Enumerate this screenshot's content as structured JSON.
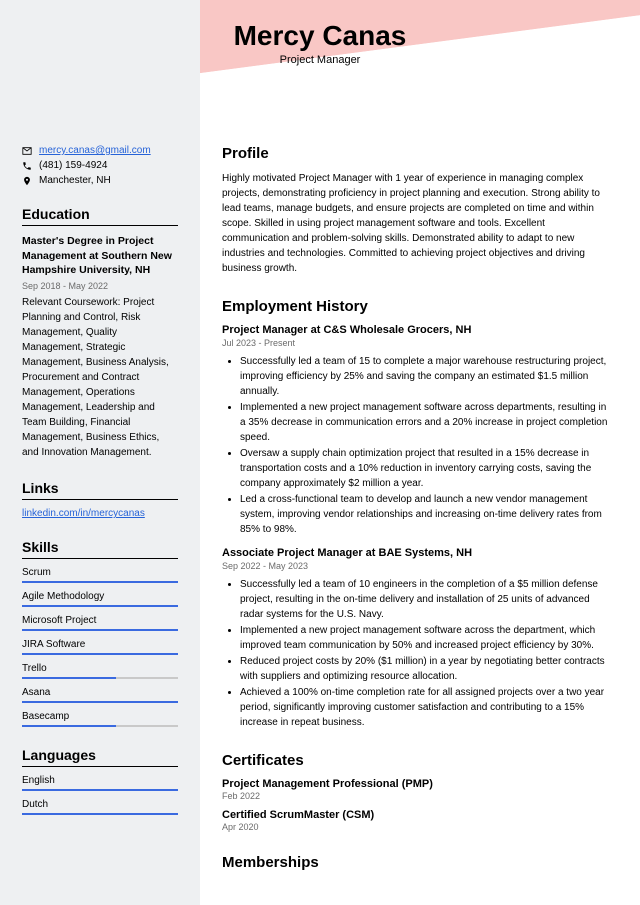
{
  "header": {
    "name": "Mercy Canas",
    "title": "Project Manager"
  },
  "contact": {
    "email": "mercy.canas@gmail.com",
    "phone": "(481) 159-4924",
    "location": "Manchester, NH"
  },
  "education": {
    "heading": "Education",
    "degree": "Master's Degree in Project Management at Southern New Hampshire University, NH",
    "dates": "Sep 2018 - May 2022",
    "coursework": "Relevant Coursework: Project Planning and Control, Risk Management, Quality Management, Strategic Management, Business Analysis, Procurement and Contract Management, Operations Management, Leadership and Team Building, Financial Management, Business Ethics, and Innovation Management."
  },
  "links": {
    "heading": "Links",
    "url": "linkedin.com/in/mercycanas"
  },
  "skills": {
    "heading": "Skills",
    "items": [
      {
        "name": "Scrum",
        "pct": 100
      },
      {
        "name": "Agile Methodology",
        "pct": 100
      },
      {
        "name": "Microsoft Project",
        "pct": 100
      },
      {
        "name": "JIRA Software",
        "pct": 100
      },
      {
        "name": "Trello",
        "pct": 60
      },
      {
        "name": "Asana",
        "pct": 100
      },
      {
        "name": "Basecamp",
        "pct": 60
      }
    ]
  },
  "languages": {
    "heading": "Languages",
    "items": [
      {
        "name": "English",
        "pct": 100
      },
      {
        "name": "Dutch",
        "pct": 100
      }
    ]
  },
  "profile": {
    "heading": "Profile",
    "text": "Highly motivated Project Manager with 1 year of experience in managing complex projects, demonstrating proficiency in project planning and execution. Strong ability to lead teams, manage budgets, and ensure projects are completed on time and within scope. Skilled in using project management software and tools. Excellent communication and problem-solving skills. Demonstrated ability to adapt to new industries and technologies. Committed to achieving project objectives and driving business growth."
  },
  "employment": {
    "heading": "Employment History",
    "jobs": [
      {
        "title": "Project Manager at C&S Wholesale Grocers, NH",
        "dates": "Jul 2023 - Present",
        "bullets": [
          "Successfully led a team of 15 to complete a major warehouse restructuring project, improving efficiency by 25% and saving the company an estimated $1.5 million annually.",
          "Implemented a new project management software across departments, resulting in a 35% decrease in communication errors and a 20% increase in project completion speed.",
          "Oversaw a supply chain optimization project that resulted in a 15% decrease in transportation costs and a 10% reduction in inventory carrying costs, saving the company approximately $2 million a year.",
          "Led a cross-functional team to develop and launch a new vendor management system, improving vendor relationships and increasing on-time delivery rates from 85% to 98%."
        ]
      },
      {
        "title": "Associate Project Manager at BAE Systems, NH",
        "dates": "Sep 2022 - May 2023",
        "bullets": [
          "Successfully led a team of 10 engineers in the completion of a $5 million defense project, resulting in the on-time delivery and installation of 25 units of advanced radar systems for the U.S. Navy.",
          "Implemented a new project management software across the department, which improved team communication by 50% and increased project efficiency by 30%.",
          "Reduced project costs by 20% ($1 million) in a year by negotiating better contracts with suppliers and optimizing resource allocation.",
          "Achieved a 100% on-time completion rate for all assigned projects over a two year period, significantly improving customer satisfaction and contributing to a 15% increase in repeat business."
        ]
      }
    ]
  },
  "certificates": {
    "heading": "Certificates",
    "items": [
      {
        "title": "Project Management Professional (PMP)",
        "date": "Feb 2022"
      },
      {
        "title": "Certified ScrumMaster (CSM)",
        "date": "Apr 2020"
      }
    ]
  },
  "memberships": {
    "heading": "Memberships"
  }
}
